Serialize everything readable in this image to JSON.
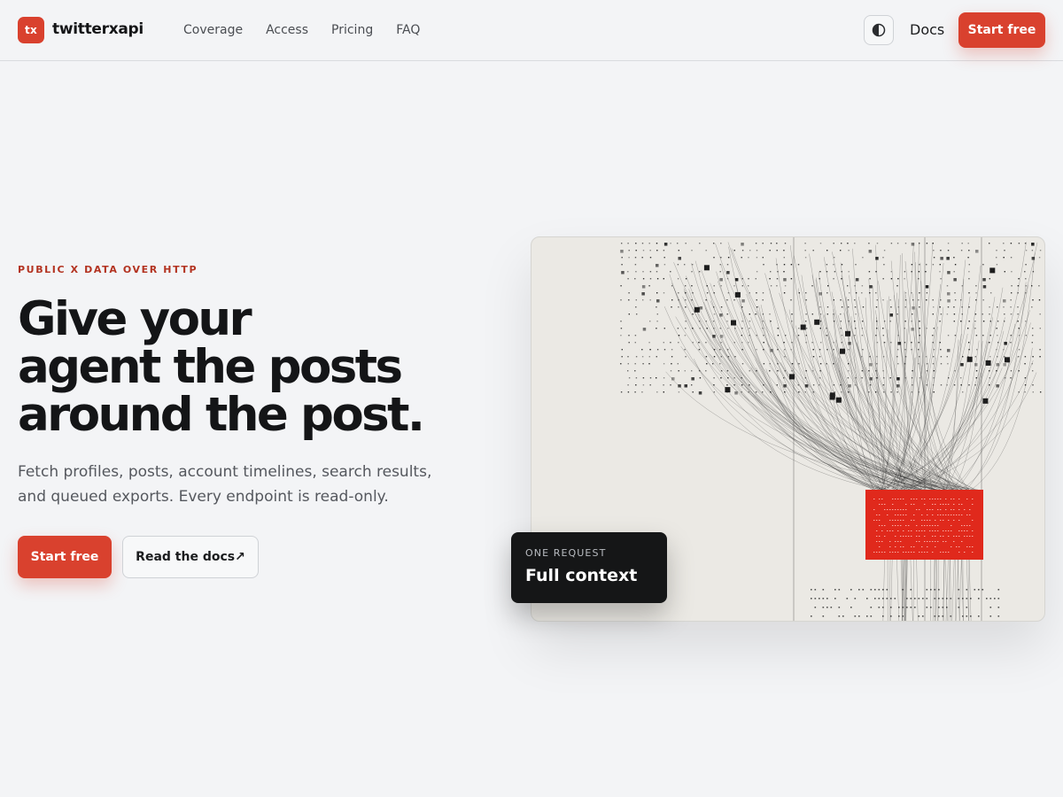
{
  "header": {
    "logo_text": "tx",
    "brand": "twitterxapi",
    "nav": [
      "Coverage",
      "Access",
      "Pricing",
      "FAQ"
    ],
    "theme_icon": "half-circle-icon",
    "docs_label": "Docs",
    "cta_label": "Start free"
  },
  "hero": {
    "eyebrow": "PUBLIC X DATA OVER HTTP",
    "headline": [
      "Give your",
      "agent the posts",
      "around the post."
    ],
    "subcopy": "Fetch profiles, posts, account timelines, search results, and queued exports. Every endpoint is read-only.",
    "primary_cta": "Start free",
    "secondary_cta": "Read the docs↗"
  },
  "illustration": {
    "description_icon": "data-funnel-illustration",
    "accent": "#e0291c",
    "badge": {
      "label": "ONE REQUEST",
      "title": "Full context"
    }
  },
  "colors": {
    "accent": "#d9412e",
    "background": "#f3f4f6",
    "text": "#141517"
  }
}
